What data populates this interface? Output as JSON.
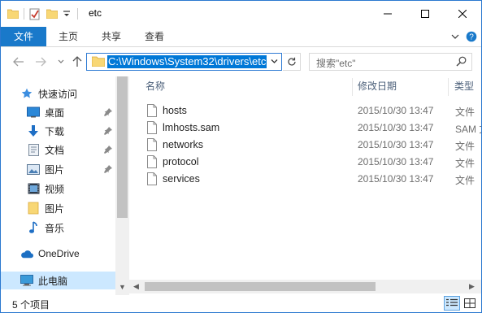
{
  "window": {
    "title": "etc"
  },
  "title_buttons": {
    "minimize": "minimize-icon",
    "maximize": "maximize-icon",
    "close": "close-icon"
  },
  "ribbon": {
    "tabs": [
      {
        "label": "文件"
      },
      {
        "label": "主页"
      },
      {
        "label": "共享"
      },
      {
        "label": "查看"
      }
    ]
  },
  "nav": {
    "address": "C:\\Windows\\System32\\drivers\\etc",
    "search_placeholder": "搜索\"etc\""
  },
  "sidebar": {
    "items": [
      {
        "label": "快速访问",
        "icon": "star-icon"
      },
      {
        "label": "桌面",
        "icon": "desktop-icon",
        "pinned": true
      },
      {
        "label": "下载",
        "icon": "download-icon",
        "pinned": true
      },
      {
        "label": "文档",
        "icon": "document-icon",
        "pinned": true
      },
      {
        "label": "图片",
        "icon": "picture-icon",
        "pinned": true
      },
      {
        "label": "视频",
        "icon": "video-icon"
      },
      {
        "label": "图片",
        "icon": "folder-icon"
      },
      {
        "label": "音乐",
        "icon": "music-icon"
      },
      {
        "label": "OneDrive",
        "icon": "cloud-icon"
      },
      {
        "label": "此电脑",
        "icon": "computer-icon",
        "selected": true
      }
    ]
  },
  "columns": {
    "name": "名称",
    "date": "修改日期",
    "type": "类型"
  },
  "files": [
    {
      "name": "hosts",
      "date": "2015/10/30 13:47",
      "type": "文件"
    },
    {
      "name": "lmhosts.sam",
      "date": "2015/10/30 13:47",
      "type": "SAM 文"
    },
    {
      "name": "networks",
      "date": "2015/10/30 13:47",
      "type": "文件"
    },
    {
      "name": "protocol",
      "date": "2015/10/30 13:47",
      "type": "文件"
    },
    {
      "name": "services",
      "date": "2015/10/30 13:47",
      "type": "文件"
    }
  ],
  "status": {
    "item_count": "5 个项目"
  },
  "colors": {
    "accent": "#1979ca",
    "selection": "#cce8ff",
    "address_highlight": "#0078d7",
    "folder": "#f8d775"
  }
}
